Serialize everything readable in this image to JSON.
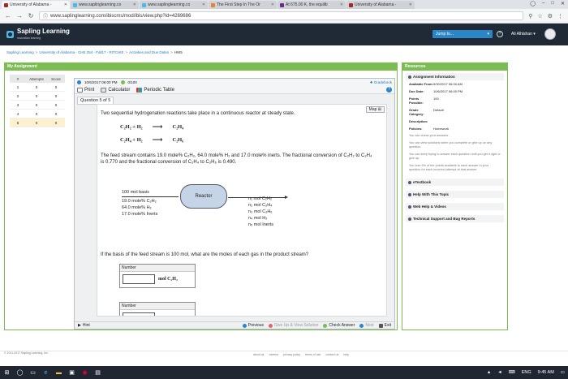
{
  "browser": {
    "tabs": [
      {
        "title": "University of Alabama -",
        "color": "#9a2c2c",
        "active": true
      },
      {
        "title": "www.saplinglearning.co",
        "color": "#4ab9e8",
        "active": false
      },
      {
        "title": "www.saplinglearning.co",
        "color": "#4ab9e8",
        "active": false
      },
      {
        "title": "The First Step In The Or",
        "color": "#e8842c",
        "active": false
      },
      {
        "title": "At 675.00 K, the equilib",
        "color": "#6a2c8c",
        "active": false
      },
      {
        "title": "University of Alabama -",
        "color": "#9a2c2c",
        "active": false
      }
    ],
    "url": "www.saplinglearning.com/ibiscms/mod/ibis/view.php?id=4269686"
  },
  "header": {
    "logo_title": "Sapling Learning",
    "logo_sub": "macmillan learning",
    "jump_label": "Jump to...",
    "username": "Ali Alhishan"
  },
  "breadcrumb": [
    "Sapling Learning",
    "University of Alabama - CHE 254 - Fall17 - RITCHIE",
    "Activities and Due Dates",
    "HW5"
  ],
  "assignment": {
    "panel_title": "My Assignment",
    "columns": [
      "#",
      "Attempts",
      "Score"
    ],
    "rows": [
      {
        "num": "1",
        "attempts": "0",
        "score": "0"
      },
      {
        "num": "2",
        "attempts": "0",
        "score": "0"
      },
      {
        "num": "3",
        "attempts": "0",
        "score": "0"
      },
      {
        "num": "4",
        "attempts": "0",
        "score": "0"
      },
      {
        "num": "5",
        "attempts": "0",
        "score": "0"
      }
    ],
    "current_row": 4
  },
  "problem": {
    "timestamp": "10/6/2017 06:00 PM",
    "points": "0/100",
    "gradebook": "Gradebook",
    "print_label": "Print",
    "calculator_label": "Calculator",
    "periodic_label": "Periodic Table",
    "question_label": "Question 5 of 5",
    "map_label": "Map",
    "stem": "Two sequential hydrogenation reactions take place in a continuous reactor at steady state.",
    "eq1_left": "C₂H₂ + H₂",
    "eq1_right": "C₂H₄",
    "eq2_left": "C₂H₄ + H₂",
    "eq2_right": "C₂H₆",
    "paragraph": "The feed stream contains 19.0 mole% C₂H₂, 64.0 mole% H₂ and 17.0 mole% inerts. The fractional conversion of C₂H₂ to C₂H₄ is 0.770 and the fractional conversion of C₂H₄ to C₂H₆ is 0.490.",
    "feed": [
      "100 mol basis",
      "19.0 mole% C₂H₂",
      "64.0 mole% H₂",
      "17.0 mole% Inerts"
    ],
    "reactor_label": "Reactor",
    "products": [
      "n₁ mol C₂H₂",
      "n₂ mol C₂H₄",
      "n₃ mol C₂H₆",
      "n₄ mol H₂",
      "n₅ mol Inerts"
    ],
    "question": "If the basis of the feed stream is 100 mol, what are the moles of each gas in the product stream?",
    "answers": [
      {
        "label": "Number",
        "value": "",
        "unit": "mol  C₂H₂"
      },
      {
        "label": "Number",
        "value": "",
        "unit": ""
      }
    ],
    "hint_label": "Hint",
    "previous_label": "Previous",
    "giveup_label": "Give Up & View Solution",
    "check_label": "Check Answer",
    "next_label": "Next",
    "exit_label": "Exit"
  },
  "resources": {
    "title": "Resources",
    "info_title": "Assignment Information",
    "info": [
      {
        "k": "Available From:",
        "v": "9/30/2017 06:00 AM"
      },
      {
        "k": "Due Date:",
        "v": "10/6/2017 06:00 PM"
      },
      {
        "k": "Points Possible:",
        "v": "100"
      },
      {
        "k": "Grade Category:",
        "v": "Default"
      },
      {
        "k": "Description:",
        "v": ""
      },
      {
        "k": "Policies:",
        "v": "Homework"
      }
    ],
    "notes": [
      "You can check your answers.",
      "You can view solutions when you complete or give up on any question.",
      "You can keep trying to answer each question until you get it right or give up.",
      "You lose 5% of the points available to each answer in your question for each incorrect attempt at that answer."
    ],
    "sections": [
      "eTextbook",
      "Help With This Topic",
      "Web Help & Videos",
      "Technical Support and Bug Reports"
    ]
  },
  "footer": {
    "copyright": "© 2011-2017 Sapling Learning, Inc.",
    "links": [
      "about us",
      "careers",
      "privacy policy",
      "terms of use",
      "contact us",
      "help"
    ]
  },
  "taskbar": {
    "lang": "ENG",
    "time": "9:45 AM"
  }
}
